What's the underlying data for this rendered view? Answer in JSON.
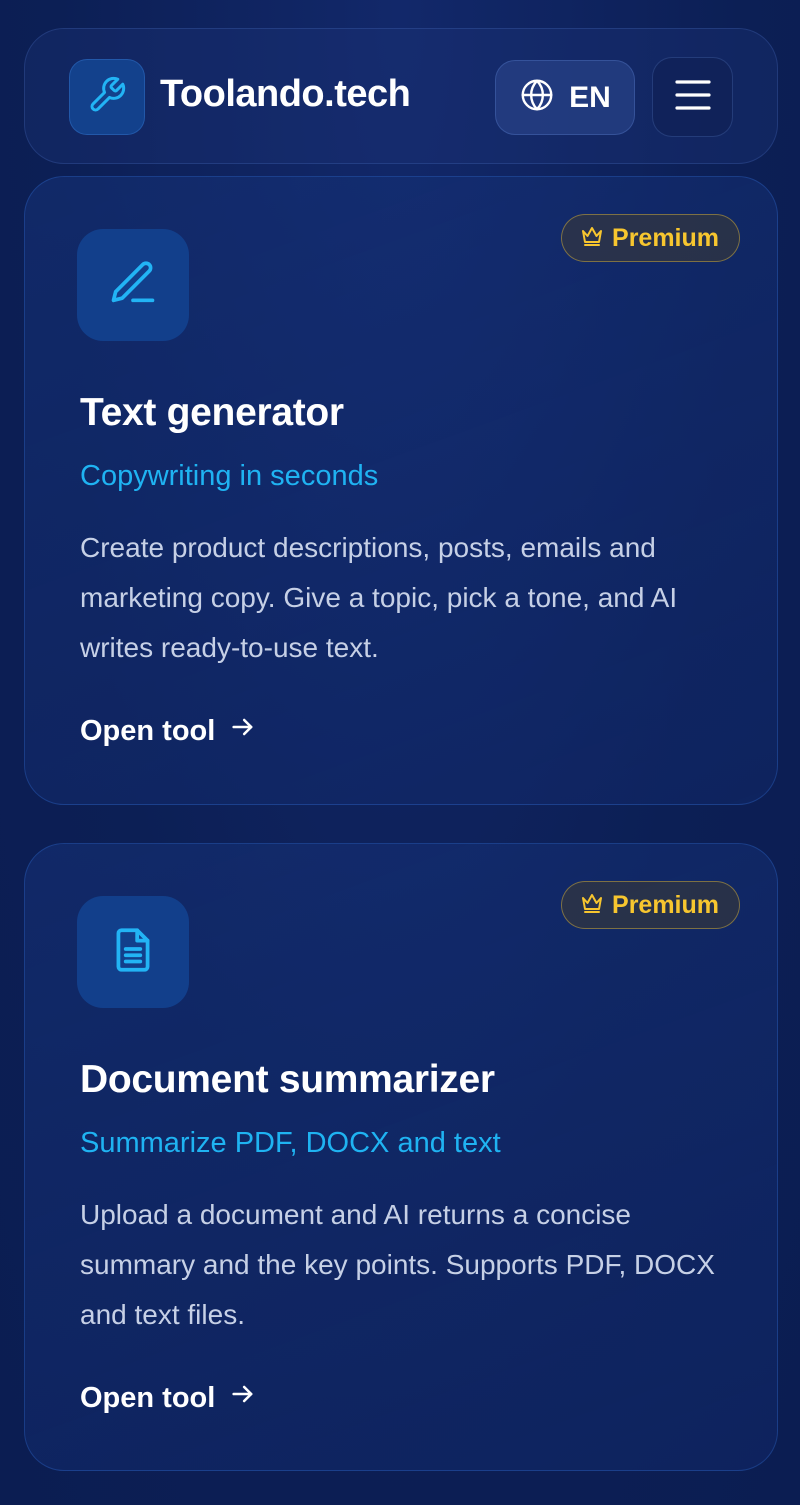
{
  "header": {
    "brand": "Toolando.tech",
    "language_label": "EN",
    "logo_icon": "wrench-icon",
    "language_icon": "globe-icon",
    "menu_icon": "hamburger-menu-icon"
  },
  "colors": {
    "background": "#0c1f55",
    "accent": "#1fb3f2",
    "premium": "#f7c62f",
    "body_text": "#c6d0e6"
  },
  "cards": [
    {
      "icon": "pencil-icon",
      "badge": "Premium",
      "badge_icon": "crown-icon",
      "title": "Text generator",
      "subtitle": "Copywriting in seconds",
      "description": "Create product descriptions, posts, emails and marketing copy. Give a topic, pick a tone, and AI writes ready-to-use text.",
      "link_label": "Open tool",
      "link_icon": "arrow-right-icon"
    },
    {
      "icon": "document-icon",
      "badge": "Premium",
      "badge_icon": "crown-icon",
      "title": "Document summarizer",
      "subtitle": "Summarize PDF, DOCX and text",
      "description": "Upload a document and AI returns a concise summary and the key points. Supports PDF, DOCX and text files.",
      "link_label": "Open tool",
      "link_icon": "arrow-right-icon"
    }
  ]
}
